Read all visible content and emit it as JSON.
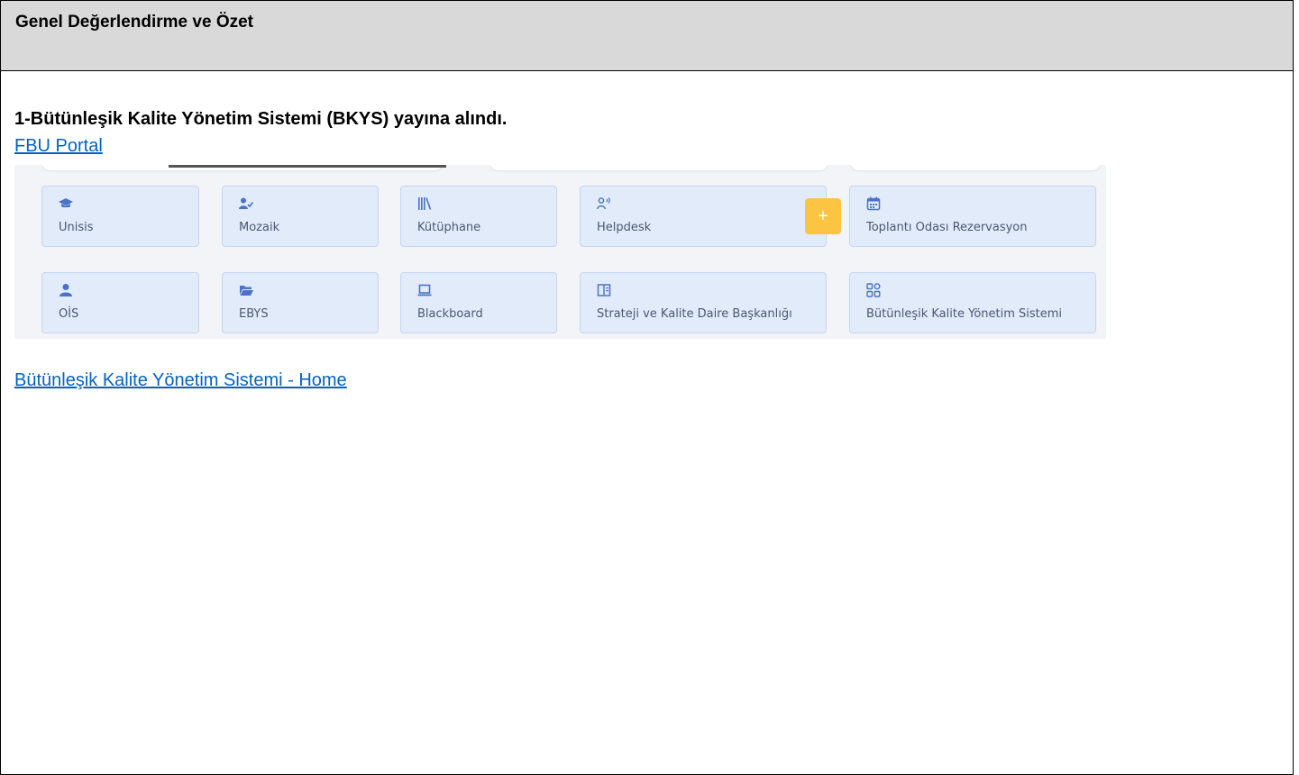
{
  "section_header": {
    "title": "Genel Değerlendirme ve Özet"
  },
  "item": {
    "heading": "1-Bütünleşik Kalite Yönetim Sistemi (BKYS) yayına alındı.",
    "portal_link": "FBU Portal",
    "home_link": "Bütünleşik Kalite Yönetim Sistemi - Home"
  },
  "portal_tiles": [
    {
      "label": "Unisis",
      "icon": "graduation-cap-icon"
    },
    {
      "label": "Mozaik",
      "icon": "user-check-icon"
    },
    {
      "label": "Kütüphane",
      "icon": "library-books-icon"
    },
    {
      "label": "Helpdesk",
      "icon": "support-agent-icon",
      "action": "+"
    },
    {
      "label": "Toplantı Odası Rezervasyon",
      "icon": "calendar-icon"
    },
    {
      "label": "OİS",
      "icon": "user-icon"
    },
    {
      "label": "EBYS",
      "icon": "folder-open-icon"
    },
    {
      "label": "Blackboard",
      "icon": "laptop-icon"
    },
    {
      "label": "Strateji ve Kalite Daire Başkanlığı",
      "icon": "book-open-icon"
    },
    {
      "label": "Bütünleşik Kalite Yönetim Sistemi",
      "icon": "grid-apps-icon"
    }
  ],
  "colors": {
    "header_bg": "#d9d9d9",
    "link": "#0563c1",
    "tile_bg": "#e2ebfa",
    "tile_icon": "#4a73c5",
    "accent_button": "#fcc443"
  }
}
